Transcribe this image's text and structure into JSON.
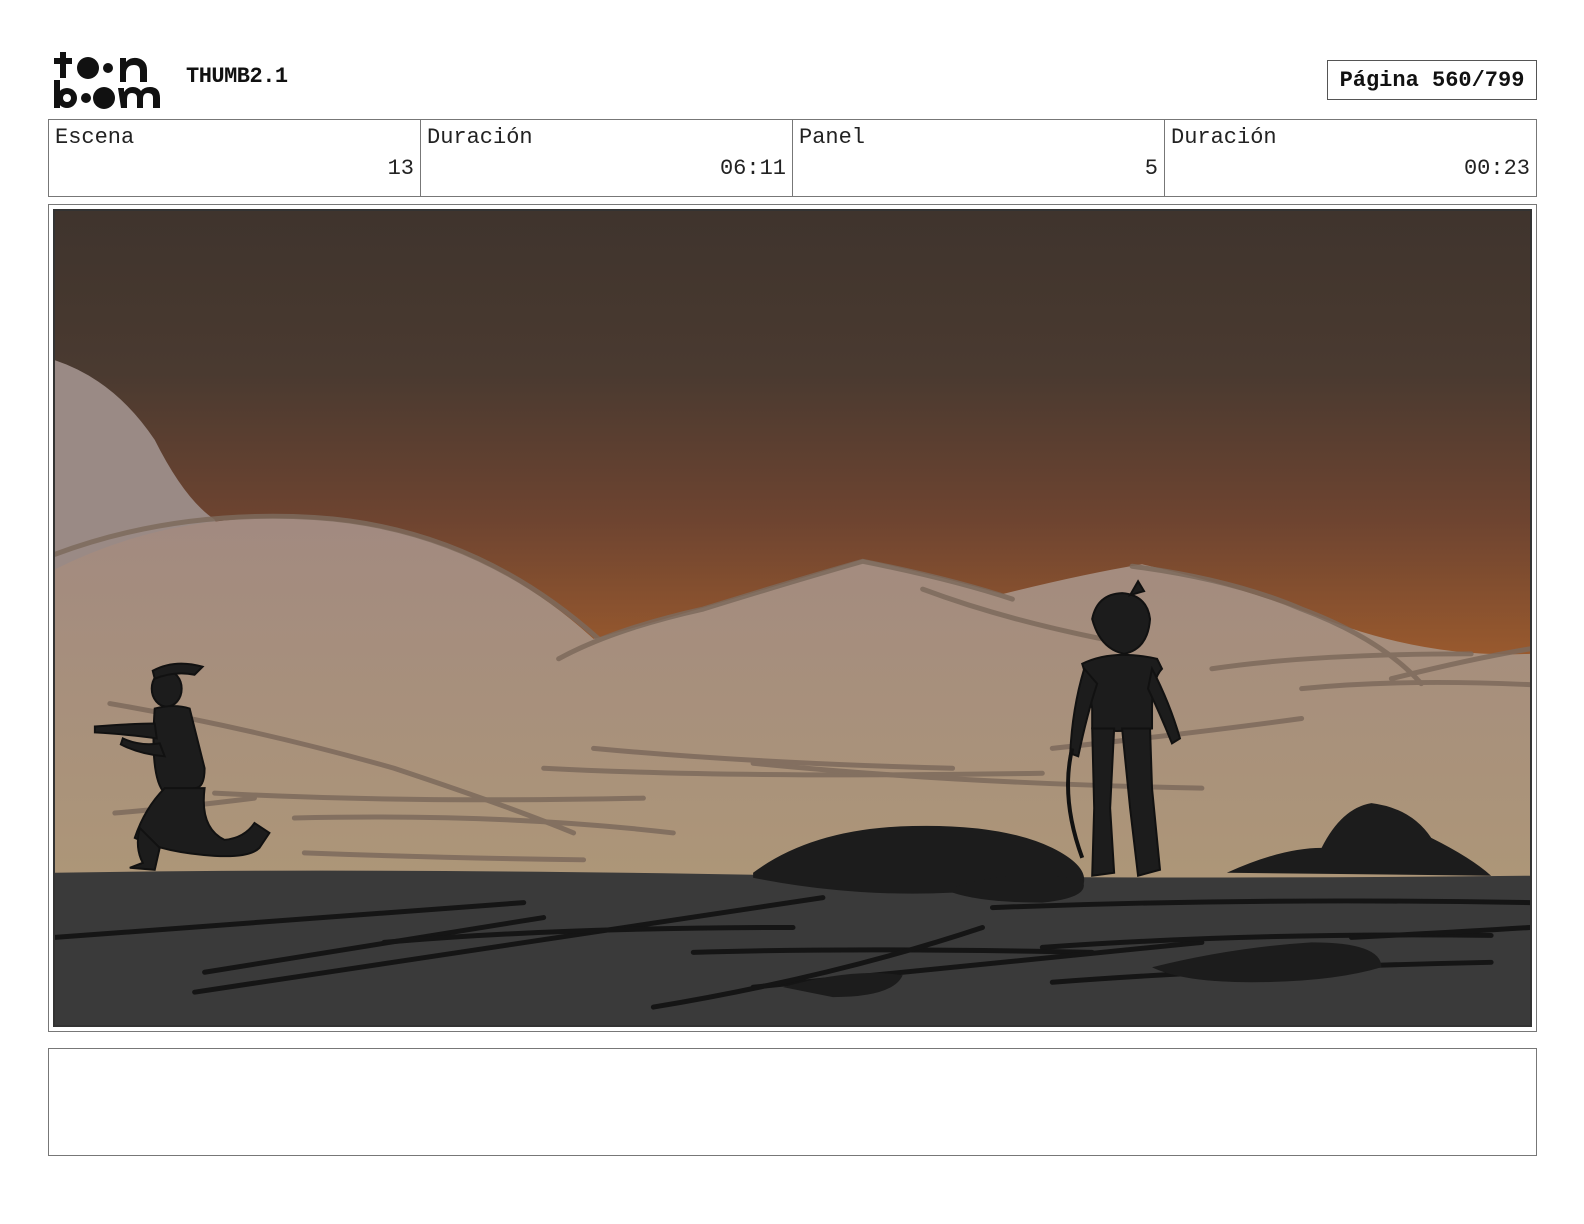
{
  "header": {
    "logo_text": "toon boom",
    "project_title": "THUMB2.1",
    "page_label": "Página 560/799"
  },
  "info": [
    {
      "label": "Escena",
      "value": "13"
    },
    {
      "label": "Duración",
      "value": "06:11"
    },
    {
      "label": "Panel",
      "value": "5"
    },
    {
      "label": "Duración",
      "value": "00:23"
    }
  ],
  "panel": {
    "art_description_icon": "storyboard-sketch-desert-two-figures",
    "colors": {
      "sky_top": "#3f342d",
      "sky_mid": "#7a4a30",
      "sky_bottom": "#b5652a",
      "dune": "#a8927e",
      "ground": "#3a3a3a",
      "silhouette": "#1c1c1c"
    }
  },
  "notes": ""
}
